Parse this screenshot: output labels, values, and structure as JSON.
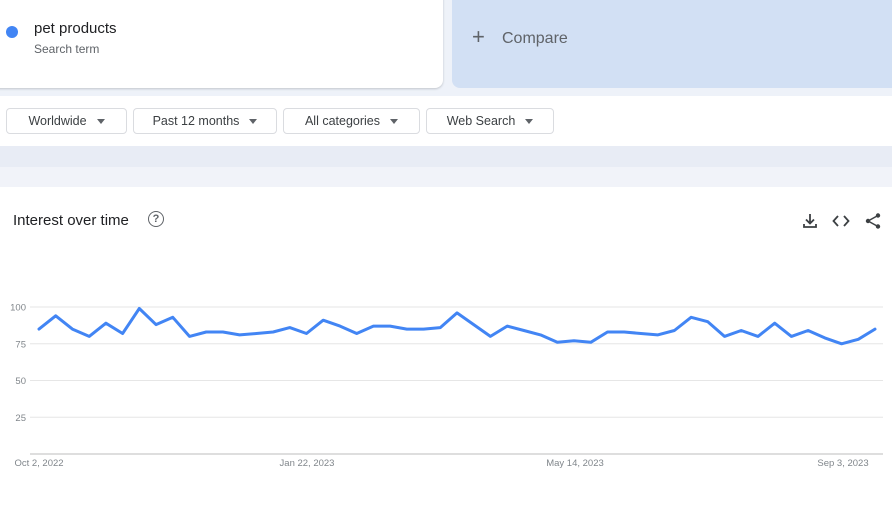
{
  "search_term": {
    "title": "pet products",
    "subtitle": "Search term",
    "color": "#4285f4"
  },
  "compare": {
    "label": "Compare",
    "icon": "plus-icon"
  },
  "filters": [
    {
      "label": "Worldwide"
    },
    {
      "label": "Past 12 months"
    },
    {
      "label": "All categories"
    },
    {
      "label": "Web Search"
    }
  ],
  "panel": {
    "title": "Interest over time",
    "help_icon": "help-icon",
    "actions": [
      "download-icon",
      "embed-icon",
      "share-icon"
    ]
  },
  "chart_data": {
    "type": "line",
    "y_ticks": [
      "100",
      "75",
      "50",
      "25"
    ],
    "x_tick_labels": [
      "Oct 2, 2022",
      "Jan 22, 2023",
      "May 14, 2023",
      "Sep 3, 2023"
    ],
    "ylim": [
      0,
      100
    ],
    "grid": true,
    "series": [
      {
        "color": "#4285f4",
        "values": [
          85,
          94,
          85,
          80,
          89,
          82,
          99,
          88,
          93,
          80,
          83,
          83,
          81,
          82,
          83,
          86,
          82,
          91,
          87,
          82,
          87,
          87,
          85,
          85,
          86,
          96,
          88,
          80,
          87,
          84,
          81,
          76,
          77,
          76,
          83,
          83,
          82,
          81,
          84,
          93,
          90,
          80,
          84,
          80,
          89,
          80,
          84,
          79,
          75,
          78,
          85
        ]
      }
    ]
  }
}
